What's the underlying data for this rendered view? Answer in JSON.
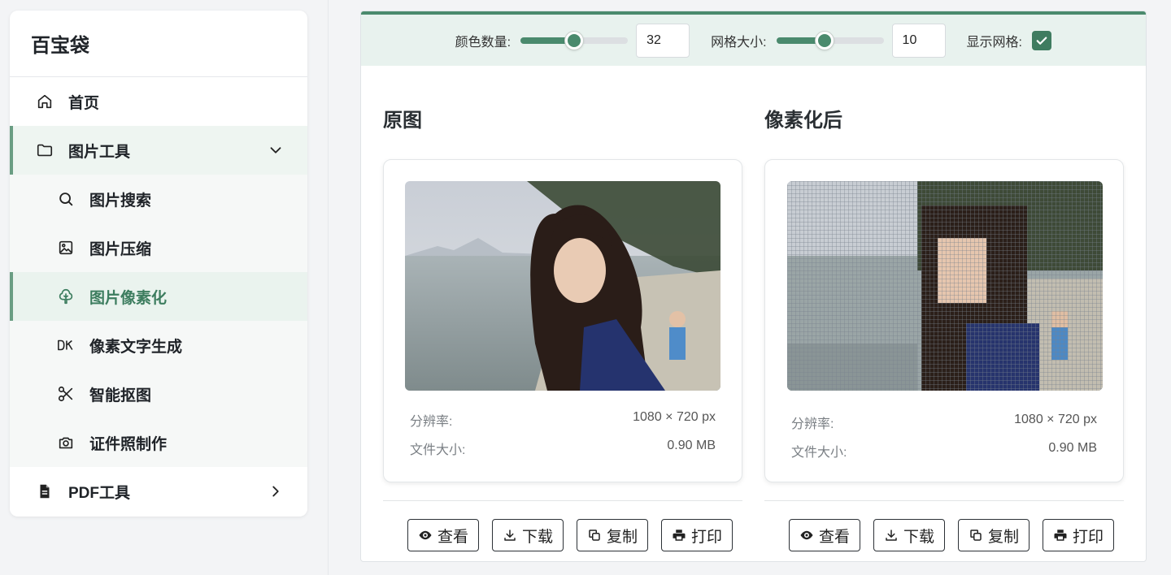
{
  "sidebar": {
    "brand": "百宝袋",
    "items": [
      {
        "label": "首页"
      },
      {
        "label": "图片工具"
      },
      {
        "label": "图片搜索"
      },
      {
        "label": "图片压缩"
      },
      {
        "label": "图片像素化"
      },
      {
        "label": "像素文字生成"
      },
      {
        "label": "智能抠图"
      },
      {
        "label": "证件照制作"
      },
      {
        "label": "PDF工具"
      }
    ]
  },
  "toolbar": {
    "color_count_label": "颜色数量:",
    "color_count_value": "32",
    "color_count_fraction": 0.5,
    "grid_size_label": "网格大小:",
    "grid_size_value": "10",
    "grid_size_fraction": 0.45,
    "show_grid_label": "显示网格:",
    "show_grid_checked": true
  },
  "original": {
    "title": "原图",
    "resolution_label": "分辨率:",
    "resolution_value": "1080 × 720 px",
    "filesize_label": "文件大小:",
    "filesize_value": "0.90 MB"
  },
  "pixelated": {
    "title": "像素化后",
    "resolution_label": "分辨率:",
    "resolution_value": "1080 × 720 px",
    "filesize_label": "文件大小:",
    "filesize_value": "0.90 MB"
  },
  "actions": {
    "view": "查看",
    "download": "下载",
    "copy": "复制",
    "print": "打印"
  },
  "colors": {
    "accent": "#4a8a6d",
    "active_bg": "#eaf3ee",
    "toolbar_bg": "#e8f2ee"
  }
}
